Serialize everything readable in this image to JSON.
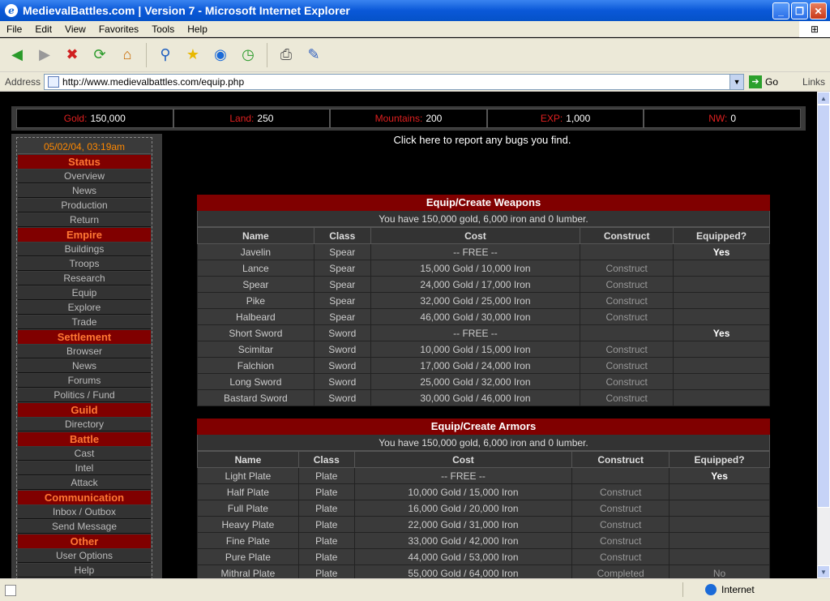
{
  "window": {
    "title": "MedievalBattles.com | Version 7 - Microsoft Internet Explorer"
  },
  "menu": [
    "File",
    "Edit",
    "View",
    "Favorites",
    "Tools",
    "Help"
  ],
  "address": {
    "label": "Address",
    "url": "http://www.medievalbattles.com/equip.php",
    "go": "Go",
    "links": "Links"
  },
  "status": {
    "zone": "Internet"
  },
  "resources": [
    {
      "label": "Gold:",
      "value": "150,000"
    },
    {
      "label": "Land:",
      "value": "250"
    },
    {
      "label": "Mountains:",
      "value": "200"
    },
    {
      "label": "EXP:",
      "value": "1,000"
    },
    {
      "label": "NW:",
      "value": "0"
    }
  ],
  "bug_link": "Click here to report any bugs you find.",
  "sidebar": {
    "date": "05/02/04, 03:19am",
    "sections": [
      {
        "head": "Status",
        "items": [
          "Overview",
          "News",
          "Production",
          "Return"
        ]
      },
      {
        "head": "Empire",
        "items": [
          "Buildings",
          "Troops",
          "Research",
          "Equip",
          "Explore",
          "Trade"
        ]
      },
      {
        "head": "Settlement",
        "items": [
          "Browser",
          "News",
          "Forums",
          "Politics / Fund"
        ]
      },
      {
        "head": "Guild",
        "items": [
          "Directory"
        ]
      },
      {
        "head": "Battle",
        "items": [
          "Cast",
          "Intel",
          "Attack"
        ]
      },
      {
        "head": "Communication",
        "items": [
          "Inbox / Outbox",
          "Send Message"
        ]
      },
      {
        "head": "Other",
        "items": [
          "User Options",
          "Help"
        ]
      }
    ]
  },
  "weapons": {
    "title": "Equip/Create Weapons",
    "subtitle": "You have 150,000 gold, 6,000 iron and 0 lumber.",
    "headers": [
      "Name",
      "Class",
      "Cost",
      "Construct",
      "Equipped?"
    ],
    "rows": [
      [
        "Javelin",
        "Spear",
        "-- FREE --",
        "",
        "Yes"
      ],
      [
        "Lance",
        "Spear",
        "15,000 Gold / 10,000 Iron",
        "Construct",
        ""
      ],
      [
        "Spear",
        "Spear",
        "24,000 Gold / 17,000 Iron",
        "Construct",
        ""
      ],
      [
        "Pike",
        "Spear",
        "32,000 Gold / 25,000 Iron",
        "Construct",
        ""
      ],
      [
        "Halbeard",
        "Spear",
        "46,000 Gold / 30,000 Iron",
        "Construct",
        ""
      ],
      [
        "Short Sword",
        "Sword",
        "-- FREE --",
        "",
        "Yes"
      ],
      [
        "Scimitar",
        "Sword",
        "10,000 Gold / 15,000 Iron",
        "Construct",
        ""
      ],
      [
        "Falchion",
        "Sword",
        "17,000 Gold / 24,000 Iron",
        "Construct",
        ""
      ],
      [
        "Long Sword",
        "Sword",
        "25,000 Gold / 32,000 Iron",
        "Construct",
        ""
      ],
      [
        "Bastard Sword",
        "Sword",
        "30,000 Gold / 46,000 Iron",
        "Construct",
        ""
      ]
    ]
  },
  "armors": {
    "title": "Equip/Create Armors",
    "subtitle": "You have 150,000 gold, 6,000 iron and 0 lumber.",
    "headers": [
      "Name",
      "Class",
      "Cost",
      "Construct",
      "Equipped?"
    ],
    "rows": [
      [
        "Light Plate",
        "Plate",
        "-- FREE --",
        "",
        "Yes"
      ],
      [
        "Half Plate",
        "Plate",
        "10,000 Gold / 15,000 Iron",
        "Construct",
        ""
      ],
      [
        "Full Plate",
        "Plate",
        "16,000 Gold / 20,000 Iron",
        "Construct",
        ""
      ],
      [
        "Heavy Plate",
        "Plate",
        "22,000 Gold / 31,000 Iron",
        "Construct",
        ""
      ],
      [
        "Fine Plate",
        "Plate",
        "33,000 Gold / 42,000 Iron",
        "Construct",
        ""
      ],
      [
        "Pure Plate",
        "Plate",
        "44,000 Gold / 53,000 Iron",
        "Construct",
        ""
      ],
      [
        "Mithral Plate",
        "Plate",
        "55,000 Gold / 64,000 Iron",
        "Completed",
        "No"
      ]
    ]
  }
}
